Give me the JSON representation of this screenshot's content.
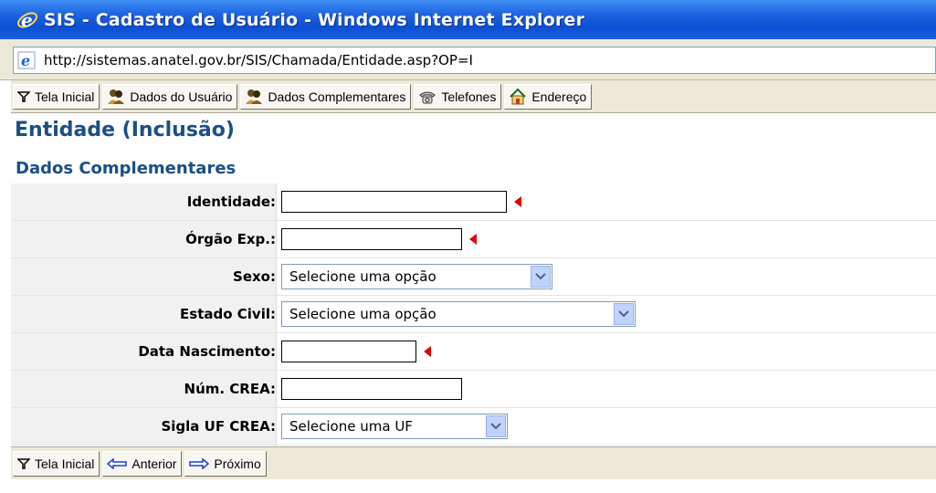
{
  "window": {
    "title": "SIS - Cadastro de Usuário - Windows Internet Explorer",
    "address": "http://sistemas.anatel.gov.br/SIS/Chamada/Entidade.asp?OP=I"
  },
  "toolbar": {
    "items": [
      {
        "label": "Tela Inicial",
        "icon": "funnel-icon"
      },
      {
        "label": "Dados do Usuário",
        "icon": "users-icon"
      },
      {
        "label": "Dados Complementares",
        "icon": "users-icon"
      },
      {
        "label": "Telefones",
        "icon": "telephone-icon"
      },
      {
        "label": "Endereço",
        "icon": "home-icon"
      }
    ]
  },
  "page": {
    "title": "Entidade (Inclusão)",
    "subtitle": "Dados Complementares"
  },
  "form": {
    "identidade": {
      "label": "Identidade:",
      "value": "",
      "required": true
    },
    "orgao": {
      "label": "Órgão Exp.:",
      "value": "",
      "required": true
    },
    "sexo": {
      "label": "Sexo:",
      "selected": "Selecione uma opção"
    },
    "estado_civil": {
      "label": "Estado Civil:",
      "selected": "Selecione uma opção"
    },
    "data_nascimento": {
      "label": "Data Nascimento:",
      "value": "",
      "required": true
    },
    "num_crea": {
      "label": "Núm. CREA:",
      "value": ""
    },
    "sigla_uf": {
      "label": "Sigla UF CREA:",
      "selected": "Selecione uma UF"
    }
  },
  "bottom_toolbar": {
    "items": [
      {
        "label": "Tela Inicial",
        "icon": "funnel-icon"
      },
      {
        "label": "Anterior",
        "icon": "arrow-left-icon"
      },
      {
        "label": "Próximo",
        "icon": "arrow-right-icon"
      }
    ]
  },
  "colors": {
    "title_bar": "#0b4fd3",
    "heading": "#1b4f86",
    "required_marker": "#e00000",
    "toolbar_bg": "#ece9d8"
  }
}
